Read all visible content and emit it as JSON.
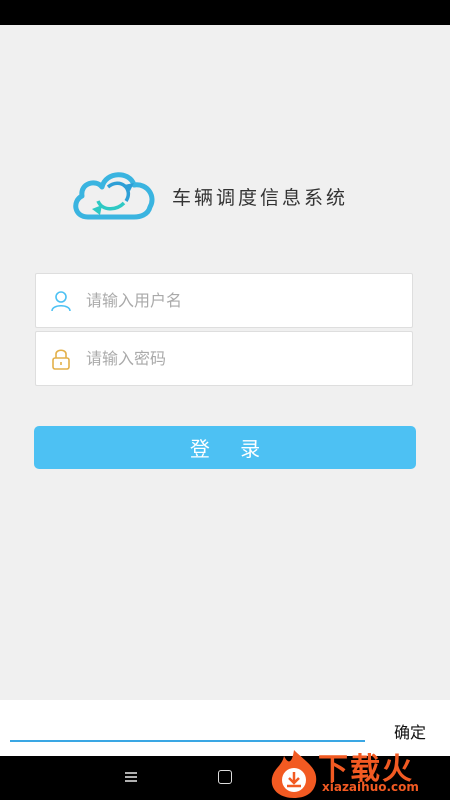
{
  "app": {
    "title": "车辆调度信息系统"
  },
  "login_form": {
    "username_placeholder": "请输入用户名",
    "password_placeholder": "请输入密码",
    "login_label": "登 录"
  },
  "ime": {
    "confirm_label": "确定"
  },
  "watermark": {
    "text": "下载火",
    "url": "xiazaihuo.com"
  },
  "colors": {
    "accent": "#4dc1f3",
    "background": "#f0f0f0",
    "watermark": "#f25a22"
  },
  "icons": [
    "cloud-sync-logo",
    "user-icon",
    "lock-icon",
    "menu-icon",
    "home-icon"
  ]
}
